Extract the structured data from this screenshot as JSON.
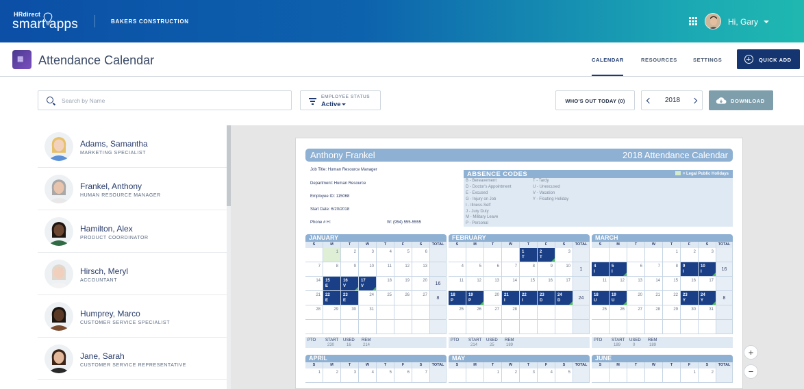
{
  "header": {
    "brand_small": "HRdirect",
    "brand_main": "smart apps",
    "company": "BAKERS CONSTRUCTION",
    "greeting": "Hi, Gary"
  },
  "subheader": {
    "title": "Attendance Calendar",
    "tabs": [
      "CALENDAR",
      "RESOURCES",
      "SETTINGS"
    ],
    "active_tab": "CALENDAR",
    "quick_add": "QUICK ADD"
  },
  "toolbar": {
    "search_placeholder": "Search by Name",
    "status_label": "EMPLOYEE STATUS",
    "status_value": "Active",
    "whos_out": "WHO'S OUT TODAY (0)",
    "year": "2018",
    "download": "DOWNLOAD"
  },
  "employees": [
    {
      "name": "Adams, Samantha",
      "title": "MARKETING SPECIALIST",
      "hair": "#e6c06a",
      "skin": "#f2d2bd",
      "shirt": "#5b8fd6"
    },
    {
      "name": "Frankel, Anthony",
      "title": "HUMAN RESOURCE MANAGER",
      "hair": "#a9a9a9",
      "skin": "#e9c4ad",
      "shirt": "#e8e8e8"
    },
    {
      "name": "Hamilton, Alex",
      "title": "PRODUCT COORDINATOR",
      "hair": "#1d1510",
      "skin": "#6b4631",
      "shirt": "#2f6a44"
    },
    {
      "name": "Hirsch, Meryl",
      "title": "ACCOUNTANT",
      "hair": "#e0d8cf",
      "skin": "#f0d0bd",
      "shirt": "#f3f3f3"
    },
    {
      "name": "Humprey, Marco",
      "title": "CUSTOMER SERVICE SPECIALIST",
      "hair": "#1a1410",
      "skin": "#5a3a27",
      "shirt": "#7a4a2e"
    },
    {
      "name": "Jane, Sarah",
      "title": "CUSTOMER SERVICE REPRESENTATIVE",
      "hair": "#3b2418",
      "skin": "#e3b89a",
      "shirt": "#2a2a2a"
    }
  ],
  "calendar": {
    "employee_name": "Anthony Frankel",
    "calendar_title": "2018 Attendance Calendar",
    "info": {
      "job_title_label": "Job Title:",
      "job_title": "Human Resource Manager",
      "department_label": "Department:",
      "department": "Human Resource",
      "employee_id_label": "Employee ID:",
      "employee_id": "115068",
      "start_date_label": "Start Date:",
      "start_date": "6/20/2018",
      "phone_label": "Phone # H:",
      "phone_work": "W: (954) 555-5555"
    },
    "absence_title": "ABSENCE CODES",
    "legal_holidays": "= Legal Public Holidays",
    "codes_col1": [
      "B - Bereavement",
      "D - Doctor's Appointment",
      "E - Excused",
      "G - Injury on Job",
      "I - Illness-Self",
      "J - Jury Duty",
      "M - Military Leave",
      "P - Personal"
    ],
    "codes_col2": [
      "T - Tardy",
      "U - Unexcused",
      "V - Vacation",
      "Y - Floating Holiday"
    ],
    "dow": [
      "S",
      "M",
      "T",
      "W",
      "T",
      "F",
      "S",
      "TOTAL"
    ],
    "pto_labels": [
      "PTO",
      "START",
      "USED",
      "REM"
    ],
    "months": [
      {
        "name": "JANUARY",
        "start": 1,
        "days": 31,
        "totals": [
          "",
          "",
          "16",
          "8",
          "",
          ""
        ],
        "holidays": [
          1,
          15
        ],
        "events": {
          "15": "E",
          "16": "V",
          "17": "V",
          "22": "E",
          "23": "E"
        },
        "green": [
          16,
          17
        ],
        "pto": [
          "230",
          "16",
          "214"
        ]
      },
      {
        "name": "FEBRUARY",
        "start": 4,
        "days": 28,
        "totals": [
          "",
          "1",
          "",
          "24",
          "",
          ""
        ],
        "holidays": [],
        "events": {
          "1": "T",
          "2": "T",
          "18": "P",
          "19": "P",
          "21": "I",
          "22": "I",
          "23": "D",
          "24": "D"
        },
        "green": [
          2,
          19,
          24
        ],
        "pto": [
          "214",
          "25",
          "189"
        ]
      },
      {
        "name": "MARCH",
        "start": 4,
        "days": 31,
        "totals": [
          "",
          "16",
          "",
          "8",
          "",
          ""
        ],
        "holidays": [],
        "events": {
          "4": "I",
          "5": "I",
          "9": "I",
          "10": "I",
          "18": "U",
          "19": "U",
          "23": "Y",
          "24": "Y"
        },
        "green": [
          5,
          10,
          19,
          24
        ],
        "pto": [
          "189",
          "0",
          "189"
        ]
      },
      {
        "name": "APRIL",
        "start": 0,
        "days": 30,
        "totals": [],
        "holidays": [],
        "events": {
          "8": "",
          "9": "",
          "10": "",
          "11": ""
        },
        "green": [],
        "pto": []
      },
      {
        "name": "MAY",
        "start": 2,
        "days": 31,
        "totals": [],
        "holidays": [],
        "events": {
          "10": ""
        },
        "green": [],
        "pto": []
      },
      {
        "name": "JUNE",
        "start": 5,
        "days": 30,
        "totals": [],
        "holidays": [],
        "events": {
          "8": "",
          "9": ""
        },
        "green": [],
        "pto": []
      }
    ]
  },
  "colors": {
    "brand_navy": "#14356f",
    "calendar_blue": "#8eb0d3",
    "absence_cell": "#1a3f86",
    "holiday_green": "#deefd5"
  }
}
